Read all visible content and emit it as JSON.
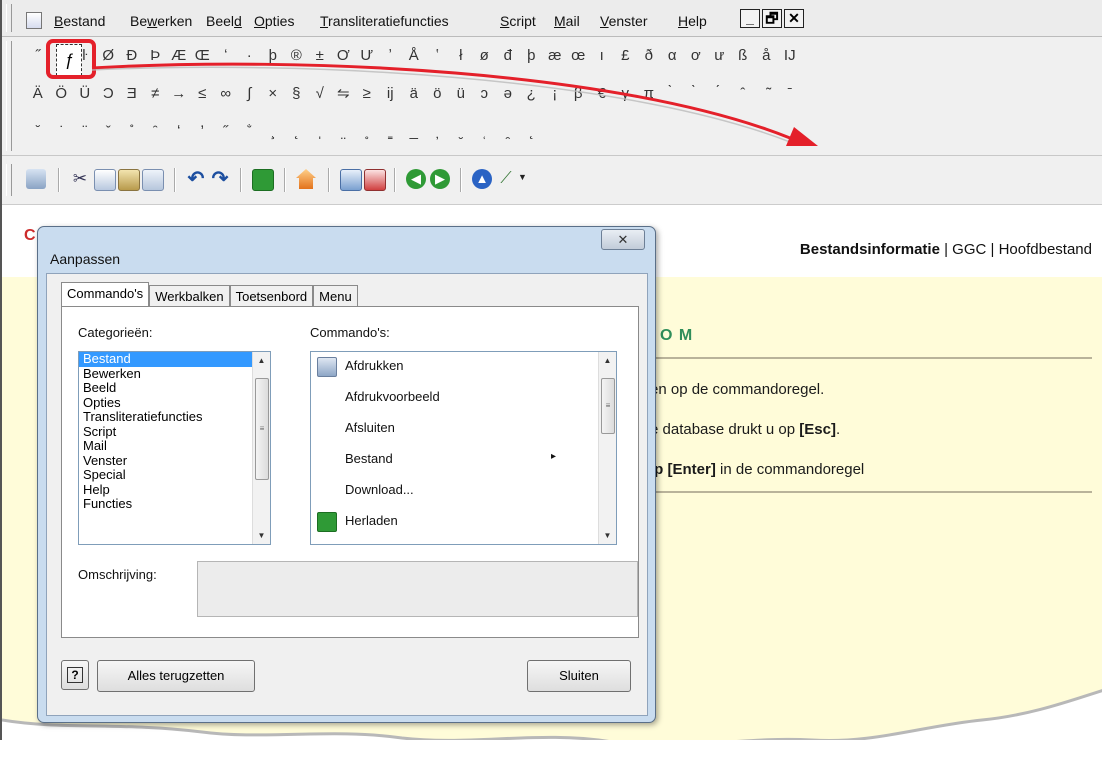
{
  "menubar": {
    "items": [
      {
        "pre": "",
        "u": "B",
        "post": "estand"
      },
      {
        "pre": "Be",
        "u": "w",
        "post": "erken"
      },
      {
        "pre": "Beel",
        "u": "d",
        "post": ""
      },
      {
        "pre": "",
        "u": "O",
        "post": "pties"
      },
      {
        "pre": "",
        "u": "T",
        "post": "ransliteratiefuncties"
      },
      {
        "pre": "",
        "u": "S",
        "post": "cript"
      },
      {
        "pre": "",
        "u": "M",
        "post": "ail"
      },
      {
        "pre": "",
        "u": "V",
        "post": "enster"
      },
      {
        "pre": "",
        "u": "H",
        "post": "elp"
      }
    ],
    "controls": [
      "_",
      "🗗",
      "✕"
    ]
  },
  "charbar": {
    "row1": [
      "˝",
      "ƒ",
      "ŀ",
      "Ø",
      "Đ",
      "Þ",
      "Æ",
      "Œ",
      "ʻ",
      "·",
      "þ",
      "®",
      "±",
      "Ơ",
      "Ư",
      "ʼ",
      "Å",
      "ʽ",
      "ł",
      "ø",
      "đ",
      "þ",
      "æ",
      "œ",
      "ı",
      "£",
      "ð",
      "α",
      "ơ",
      "ư",
      "ß",
      "å",
      "IJ"
    ],
    "row2": [
      "Ä",
      "Ö",
      "Ü",
      "Ɔ",
      "Ǝ",
      "≠",
      "→",
      "≤",
      "∞",
      "∫",
      "×",
      "§",
      "√",
      "⇋",
      "≥",
      "ij",
      "ä",
      "ö",
      "ü",
      "ɔ",
      "ə",
      "¿",
      "¡",
      "β",
      "€",
      "γ",
      "π",
      "̀",
      "̀",
      "́",
      "̂",
      "̃",
      "̄"
    ],
    "row3": [
      "̆",
      "̇",
      "̈",
      "̌",
      "̊",
      "̑",
      "̒",
      "̓",
      "̋",
      "̐",
      "̧",
      "̨",
      "̩",
      "̤",
      "̥",
      "̳",
      "̲",
      "̦",
      "̮",
      "̜",
      "̯",
      "̨"
    ],
    "highlight": "ƒ"
  },
  "page": {
    "file_info_bold": "Bestandsinformatie",
    "file_info_rest": " | GGC | Hoofdbestand",
    "section_title": "O M",
    "line1": "en op de commandoregel.",
    "line2_pre": "e database drukt u op ",
    "line2_bold": "[Esc]",
    "line2_post": ".",
    "line3_bold": "lp [Enter]",
    "line3_post": " in de commandoregel"
  },
  "dialog": {
    "title": "Aanpassen",
    "close": "✕",
    "tabs": [
      "Commando's",
      "Werkbalken",
      "Toetsenbord",
      "Menu"
    ],
    "categories_label": "Categorieën:",
    "categories": [
      "Bestand",
      "Bewerken",
      "Beeld",
      "Opties",
      "Transliteratiefuncties",
      "Script",
      "Mail",
      "Venster",
      "Special",
      "Help",
      "Functies"
    ],
    "commands_label": "Commando's:",
    "commands": [
      {
        "label": "Afdrukken",
        "icon": "printer-icon"
      },
      {
        "label": "Afdrukvoorbeeld",
        "icon": ""
      },
      {
        "label": "Afsluiten",
        "icon": ""
      },
      {
        "label": "Bestand",
        "icon": "",
        "submenu": "▸"
      },
      {
        "label": "Download...",
        "icon": ""
      },
      {
        "label": "Herladen",
        "icon": "reload-icon"
      }
    ],
    "description_label": "Omschrijving:",
    "help_glyph": "?",
    "reset_button": "Alles terugzetten",
    "close_button": "Sluiten"
  },
  "colors": {
    "highlight_red": "#e4202a",
    "page_bg": "#fffcd9",
    "title_green": "#2f8e5a",
    "dialog_frame": "#c9dcef",
    "selection": "#3399ff"
  }
}
